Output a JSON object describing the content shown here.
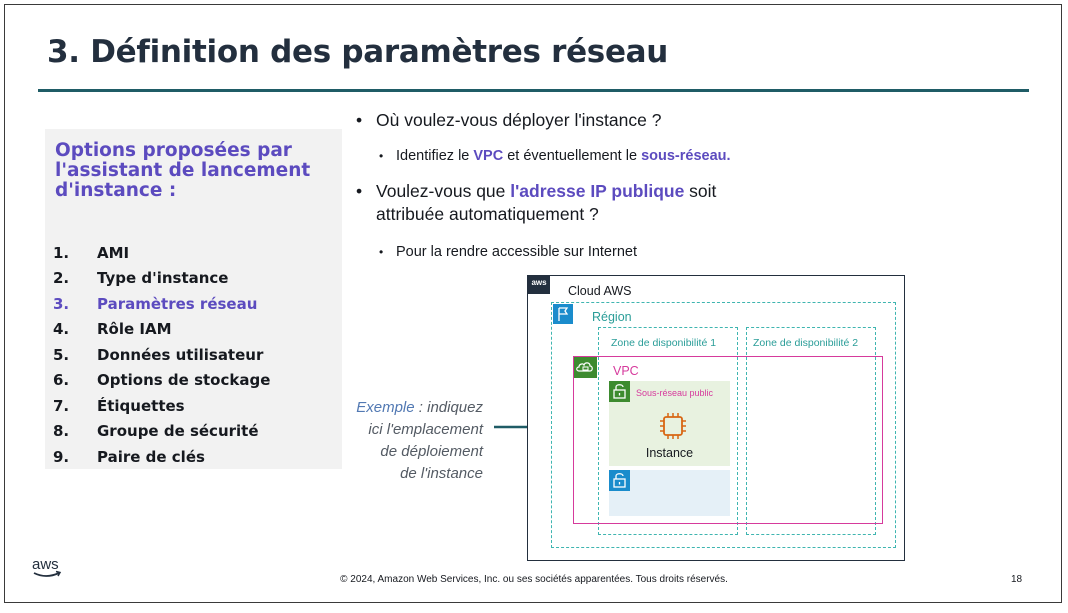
{
  "title": "3. Définition des paramètres réseau",
  "panel": {
    "heading": [
      "Options proposées par",
      "l'assistant de lancement",
      "d'instance :"
    ],
    "items": [
      {
        "num": "1.",
        "label": "AMI"
      },
      {
        "num": "2.",
        "label": "Type d'instance"
      },
      {
        "num": "3.",
        "label": "Paramètres réseau",
        "active": true
      },
      {
        "num": "4.",
        "label": "Rôle IAM"
      },
      {
        "num": "5.",
        "label": "Données utilisateur"
      },
      {
        "num": "6.",
        "label": "Options de stockage"
      },
      {
        "num": "7.",
        "label": "Étiquettes"
      },
      {
        "num": "8.",
        "label": "Groupe de sécurité"
      },
      {
        "num": "9.",
        "label": "Paire de clés"
      }
    ]
  },
  "bullets": {
    "b1": "Où voulez-vous déployer l'instance ?",
    "b2_pre": "Identifiez le ",
    "b2_hl1": "VPC",
    "b2_mid": " et éventuellement le ",
    "b2_hl2": "sous-réseau.",
    "b3_pre": "Voulez-vous que ",
    "b3_hl": "l'adresse IP publique",
    "b3_post": " soit",
    "b3_line2": "attribuée automatiquement ?",
    "b4": "Pour la rendre accessible sur Internet"
  },
  "example": {
    "word": "Exemple",
    "line1_rest": " : indiquez",
    "line2": "ici l'emplacement",
    "line3": "de déploiement",
    "line4": "de l'instance"
  },
  "diagram": {
    "aws_badge": "aws",
    "cloud": "Cloud AWS",
    "region": "Région",
    "az1": "Zone de disponibilité 1",
    "az2": "Zone de disponibilité 2",
    "vpc": "VPC",
    "public_subnet": "Sous-réseau public",
    "instance": "Instance"
  },
  "footer": {
    "logo": "aws",
    "copyright": "© 2024, Amazon Web Services, Inc. ou ses sociétés apparentées. Tous droits réservés.",
    "page": "18"
  },
  "colors": {
    "accent": "#5c4bbf",
    "rule": "#1f5c66",
    "teal": "#3fb5b0",
    "pink": "#d63a9c",
    "green": "#3d8b2f",
    "blue": "#1a8ccc",
    "orange": "#d86613"
  }
}
